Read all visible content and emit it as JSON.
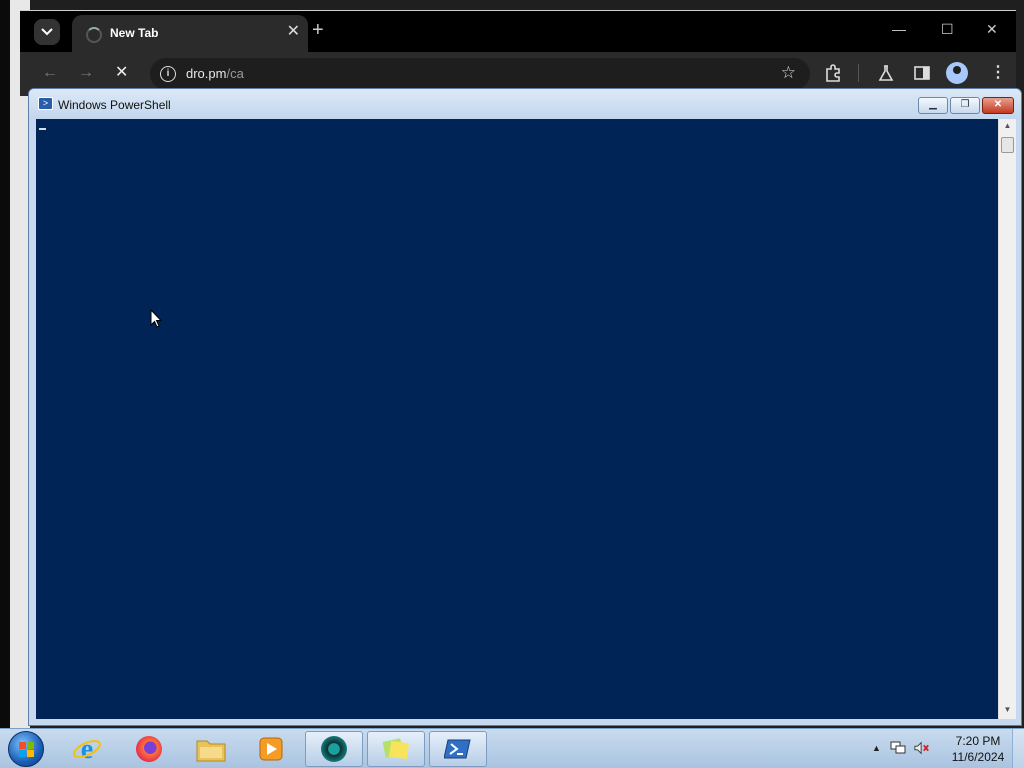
{
  "browser": {
    "tab_title": "New Tab",
    "tab_close": "✕",
    "new_tab": "+",
    "url_domain": "dro.pm",
    "url_path": "/ca",
    "window_controls": {
      "minimize": "—",
      "maximize": "☐",
      "close": "✕"
    },
    "nav": {
      "back": "←",
      "forward": "→",
      "stop": "✕"
    }
  },
  "powershell": {
    "title": "Windows PowerShell",
    "background_color": "#012456",
    "controls": {
      "minimize": "▁",
      "restore": "❐",
      "close": "✕"
    }
  },
  "taskbar": {
    "apps": [
      {
        "name": "internet-explorer",
        "label": "Internet Explorer"
      },
      {
        "name": "firefox",
        "label": "Firefox"
      },
      {
        "name": "file-explorer",
        "label": "Windows Explorer"
      },
      {
        "name": "media-player",
        "label": "Media Player"
      },
      {
        "name": "chrome",
        "label": "Google Chrome"
      },
      {
        "name": "sticky-notes",
        "label": "Sticky Notes"
      },
      {
        "name": "powershell",
        "label": "Windows PowerShell"
      }
    ],
    "clock": {
      "time": "7:20 PM",
      "date": "11/6/2024"
    }
  }
}
